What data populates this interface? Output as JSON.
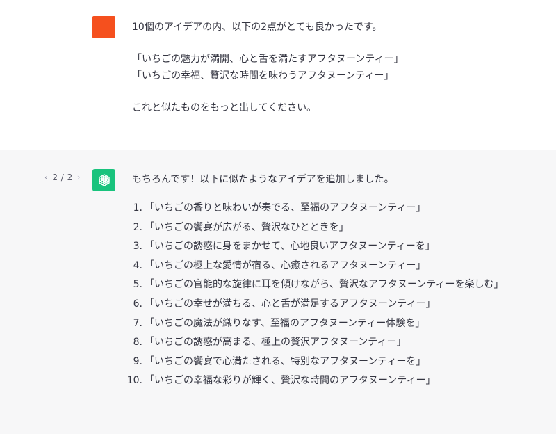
{
  "user_turn": {
    "lines": [
      "10個のアイデアの内、以下の2点がとても良かったです。",
      "",
      "「いちごの魅力が満開、心と舌を満たすアフタヌーンティー」",
      "「いちごの幸福、贅沢な時間を味わうアフタヌーンティー」",
      "",
      "これと似たものをもっと出してください。"
    ]
  },
  "assistant_turn": {
    "pager": {
      "prev_icon": "‹",
      "count": "2 / 2",
      "next_icon": "›"
    },
    "intro": "もちろんです！以下に似たようなアイデアを追加しました。",
    "ideas": [
      {
        "num": "1.",
        "text": "「いちごの香りと味わいが奏でる、至福のアフタヌーンティー」"
      },
      {
        "num": "2.",
        "text": "「いちごの饗宴が広がる、贅沢なひとときを」"
      },
      {
        "num": "3.",
        "text": "「いちごの誘惑に身をまかせて、心地良いアフタヌーンティーを」"
      },
      {
        "num": "4.",
        "text": "「いちごの極上な愛情が宿る、心癒されるアフタヌーンティー」"
      },
      {
        "num": "5.",
        "text": "「いちごの官能的な旋律に耳を傾けながら、贅沢なアフタヌーンティーを楽しむ」"
      },
      {
        "num": "6.",
        "text": "「いちごの幸せが満ちる、心と舌が満足するアフタヌーンティー」"
      },
      {
        "num": "7.",
        "text": "「いちごの魔法が織りなす、至福のアフタヌーンティー体験を」"
      },
      {
        "num": "8.",
        "text": "「いちごの誘惑が高まる、極上の贅沢アフタヌーンティー」"
      },
      {
        "num": "9.",
        "text": "「いちごの饗宴で心満たされる、特別なアフタヌーンティーを」"
      },
      {
        "num": "10.",
        "text": "「いちごの幸福な彩りが輝く、贅沢な時間のアフタヌーンティー」"
      }
    ]
  },
  "colors": {
    "user_avatar": "#f5501e",
    "assistant_avatar": "#19c37d",
    "assistant_bg": "#f7f7f8"
  }
}
